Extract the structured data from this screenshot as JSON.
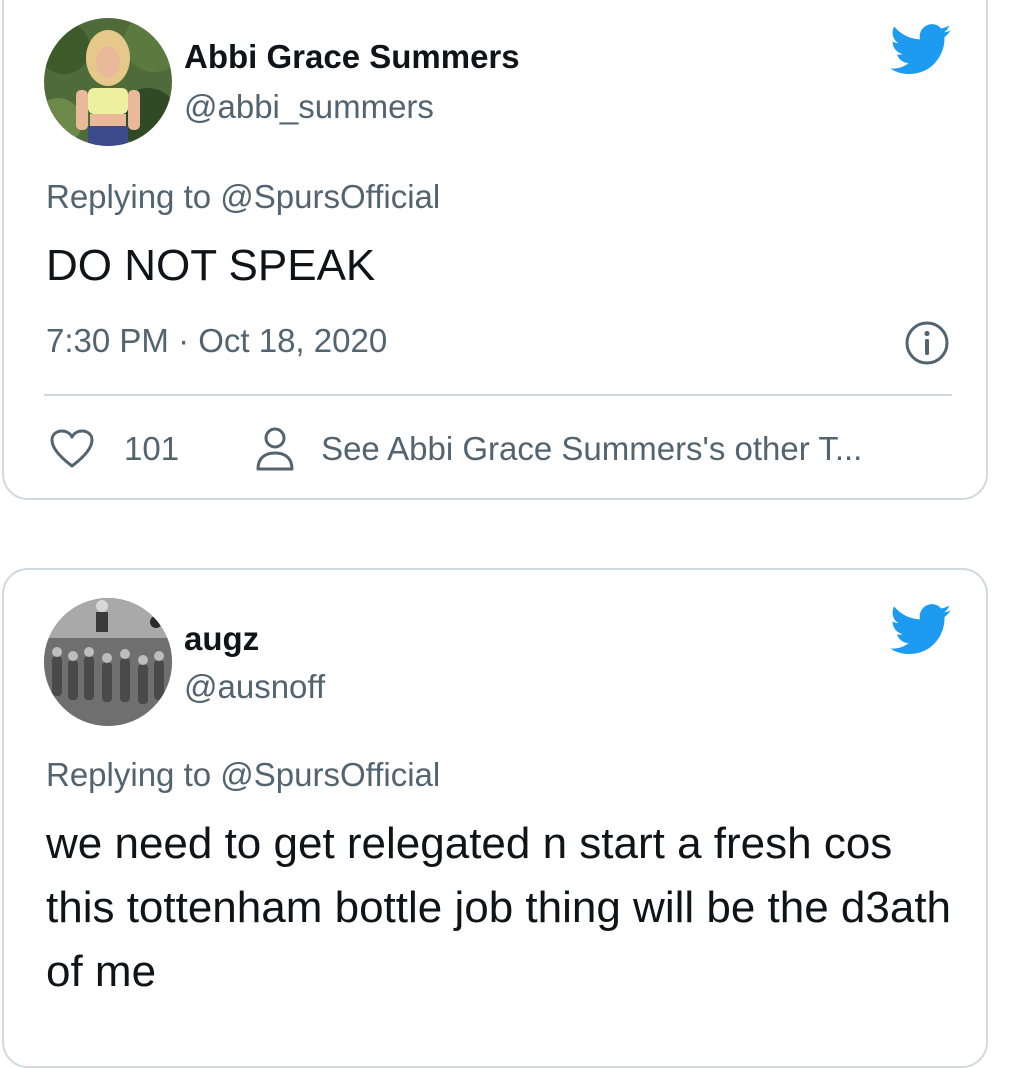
{
  "tweets": [
    {
      "display_name": "Abbi Grace Summers",
      "handle": "@abbi_summers",
      "replying_prefix": "Replying to",
      "replying_to": "@SpursOfficial",
      "text": "DO NOT SPEAK",
      "timestamp": "7:30 PM · Oct 18, 2020",
      "likes": "101",
      "see_other": "See Abbi Grace Summers's other T..."
    },
    {
      "display_name": "augz",
      "handle": "@ausnoff",
      "replying_prefix": "Replying to",
      "replying_to": "@SpursOfficial",
      "text": "we need to get relegated n start a fresh cos this tottenham bottle job thing will be the d3ath of me"
    }
  ],
  "icons": {
    "brand": "twitter-bird-icon",
    "info": "info-icon",
    "like": "heart-icon",
    "profile": "person-icon"
  },
  "colors": {
    "twitter_blue": "#1d9bf0",
    "secondary_text": "#536471",
    "border": "#cfd9de"
  }
}
